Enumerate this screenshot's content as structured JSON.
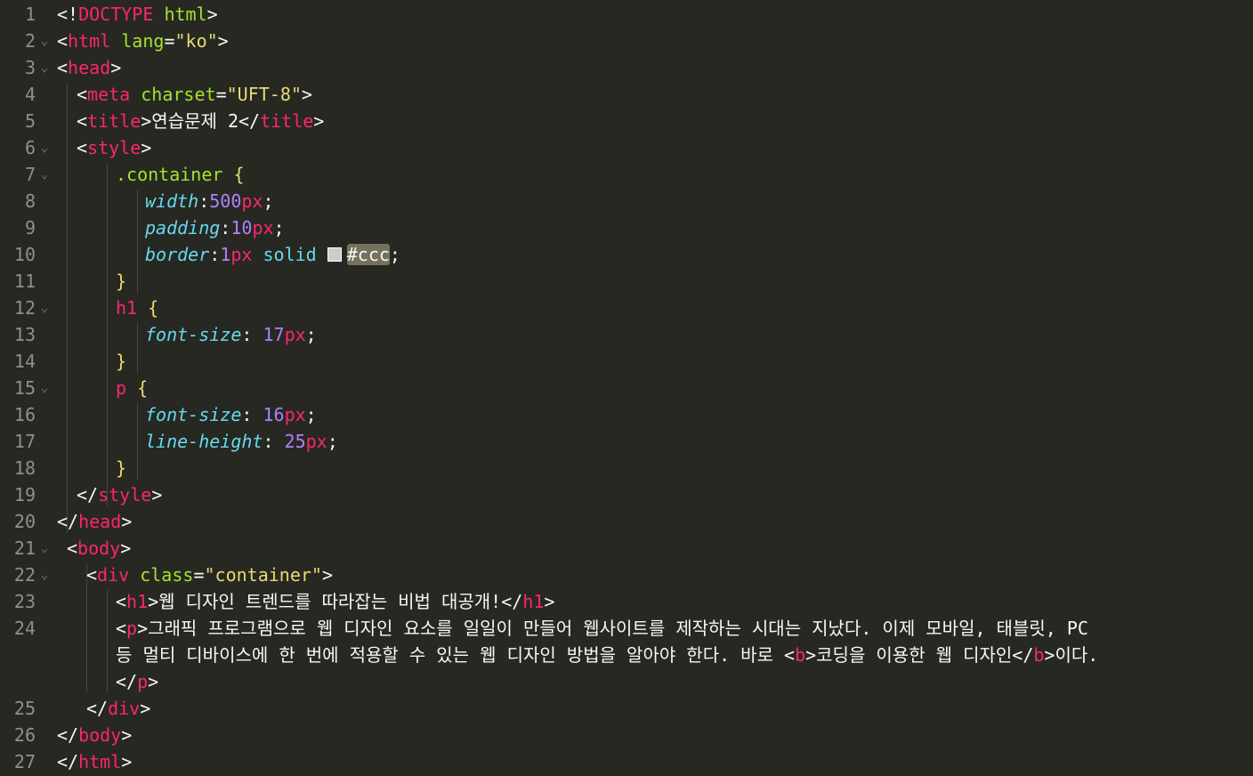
{
  "editor": {
    "language": "html",
    "theme_colors": {
      "background": "#272822",
      "foreground": "#f8f8f2",
      "line_number": "#8f908a",
      "tag": "#f92672",
      "attribute": "#a6e22e",
      "string": "#e6db74",
      "property": "#66d9ef",
      "number": "#ae81ff"
    },
    "color_swatch": "#ccc",
    "lines": [
      {
        "no": "1",
        "fold": false,
        "indent": 0,
        "tokens": [
          [
            "p",
            "<!"
          ],
          [
            "tag",
            "DOCTYPE"
          ],
          [
            "p",
            " "
          ],
          [
            "attr",
            "html"
          ],
          [
            "p",
            ">"
          ]
        ]
      },
      {
        "no": "2",
        "fold": true,
        "indent": 0,
        "tokens": [
          [
            "p",
            "<"
          ],
          [
            "tag",
            "html"
          ],
          [
            "p",
            " "
          ],
          [
            "attr",
            "lang"
          ],
          [
            "p",
            "="
          ],
          [
            "str",
            "\"ko\""
          ],
          [
            "p",
            ">"
          ]
        ]
      },
      {
        "no": "3",
        "fold": true,
        "indent": 0,
        "tokens": [
          [
            "p",
            "<"
          ],
          [
            "tag",
            "head"
          ],
          [
            "p",
            ">"
          ]
        ]
      },
      {
        "no": "4",
        "fold": false,
        "indent": 1,
        "tokens": [
          [
            "p",
            "<"
          ],
          [
            "tag",
            "meta"
          ],
          [
            "p",
            " "
          ],
          [
            "attr",
            "charset"
          ],
          [
            "p",
            "="
          ],
          [
            "str",
            "\"UFT-8\""
          ],
          [
            "p",
            ">"
          ]
        ]
      },
      {
        "no": "5",
        "fold": false,
        "indent": 1,
        "tokens": [
          [
            "p",
            "<"
          ],
          [
            "tag",
            "title"
          ],
          [
            "p",
            ">연습문제 2</"
          ],
          [
            "tag",
            "title"
          ],
          [
            "p",
            ">"
          ]
        ]
      },
      {
        "no": "6",
        "fold": true,
        "indent": 1,
        "tokens": [
          [
            "p",
            "<"
          ],
          [
            "tag",
            "style"
          ],
          [
            "p",
            ">"
          ]
        ]
      },
      {
        "no": "7",
        "fold": true,
        "indent": 3,
        "tokens": [
          [
            "sel",
            ".container"
          ],
          [
            "p",
            " "
          ],
          [
            "brace",
            "{"
          ]
        ]
      },
      {
        "no": "8",
        "fold": false,
        "indent": 4.5,
        "tokens": [
          [
            "prop",
            "width"
          ],
          [
            "p",
            ":"
          ],
          [
            "num",
            "500"
          ],
          [
            "unit",
            "px"
          ],
          [
            "p",
            ";"
          ]
        ]
      },
      {
        "no": "9",
        "fold": false,
        "indent": 4.5,
        "tokens": [
          [
            "prop",
            "padding"
          ],
          [
            "p",
            ":"
          ],
          [
            "num",
            "10"
          ],
          [
            "unit",
            "px"
          ],
          [
            "p",
            ";"
          ]
        ]
      },
      {
        "no": "10",
        "fold": false,
        "indent": 4.5,
        "tokens": [
          [
            "prop",
            "border"
          ],
          [
            "p",
            ":"
          ],
          [
            "num",
            "1"
          ],
          [
            "unit",
            "px"
          ],
          [
            "p",
            " "
          ],
          [
            "kw",
            "solid"
          ],
          [
            "p",
            " "
          ],
          [
            "swatch",
            ""
          ],
          [
            "hl",
            "#ccc"
          ],
          [
            "p",
            ";"
          ]
        ]
      },
      {
        "no": "11",
        "fold": false,
        "indent": 3,
        "tokens": [
          [
            "brace",
            "}"
          ]
        ]
      },
      {
        "no": "12",
        "fold": true,
        "indent": 3,
        "tokens": [
          [
            "tag",
            "h1"
          ],
          [
            "p",
            " "
          ],
          [
            "brace",
            "{"
          ]
        ]
      },
      {
        "no": "13",
        "fold": false,
        "indent": 4.5,
        "tokens": [
          [
            "prop",
            "font-size"
          ],
          [
            "p",
            ": "
          ],
          [
            "num",
            "17"
          ],
          [
            "unit",
            "px"
          ],
          [
            "p",
            ";"
          ]
        ]
      },
      {
        "no": "14",
        "fold": false,
        "indent": 3,
        "tokens": [
          [
            "brace",
            "}"
          ]
        ]
      },
      {
        "no": "15",
        "fold": true,
        "indent": 3,
        "tokens": [
          [
            "tag",
            "p"
          ],
          [
            "p",
            " "
          ],
          [
            "brace",
            "{"
          ]
        ]
      },
      {
        "no": "16",
        "fold": false,
        "indent": 4.5,
        "tokens": [
          [
            "prop",
            "font-size"
          ],
          [
            "p",
            ": "
          ],
          [
            "num",
            "16"
          ],
          [
            "unit",
            "px"
          ],
          [
            "p",
            ";"
          ]
        ]
      },
      {
        "no": "17",
        "fold": false,
        "indent": 4.5,
        "tokens": [
          [
            "prop",
            "line-height"
          ],
          [
            "p",
            ": "
          ],
          [
            "num",
            "25"
          ],
          [
            "unit",
            "px"
          ],
          [
            "p",
            ";"
          ]
        ]
      },
      {
        "no": "18",
        "fold": false,
        "indent": 3,
        "tokens": [
          [
            "brace",
            "}"
          ]
        ]
      },
      {
        "no": "19",
        "fold": false,
        "indent": 1,
        "tokens": [
          [
            "p",
            "</"
          ],
          [
            "tag",
            "style"
          ],
          [
            "p",
            ">"
          ]
        ]
      },
      {
        "no": "20",
        "fold": false,
        "indent": 0,
        "tokens": [
          [
            "p",
            "</"
          ],
          [
            "tag",
            "head"
          ],
          [
            "p",
            ">"
          ]
        ]
      },
      {
        "no": "21",
        "fold": true,
        "indent": 0.5,
        "tokens": [
          [
            "p",
            "<"
          ],
          [
            "tag",
            "body"
          ],
          [
            "p",
            ">"
          ]
        ]
      },
      {
        "no": "22",
        "fold": true,
        "indent": 1.5,
        "tokens": [
          [
            "p",
            "<"
          ],
          [
            "tag",
            "div"
          ],
          [
            "p",
            " "
          ],
          [
            "attr",
            "class"
          ],
          [
            "p",
            "="
          ],
          [
            "str",
            "\"container\""
          ],
          [
            "p",
            ">"
          ]
        ]
      },
      {
        "no": "23",
        "fold": false,
        "indent": 3,
        "tokens": [
          [
            "p",
            "<"
          ],
          [
            "tag",
            "h1"
          ],
          [
            "p",
            ">웹 디자인 트렌드를 따라잡는 비법 대공개!</"
          ],
          [
            "tag",
            "h1"
          ],
          [
            "p",
            ">"
          ]
        ]
      },
      {
        "no": "24",
        "fold": false,
        "indent": 3,
        "tokens": [
          [
            "p",
            "<"
          ],
          [
            "tag",
            "p"
          ],
          [
            "p",
            ">그래픽 프로그램으로 웹 디자인 요소를 일일이 만들어 웹사이트를 제작하는 시대는 지났다. 이제 모바일, 태블릿, PC"
          ]
        ]
      },
      {
        "no": "",
        "fold": false,
        "indent": 3,
        "tokens": [
          [
            "p",
            "등 멀티 디바이스에 한 번에 적용할 수 있는 웹 디자인 방법을 알아야 한다. 바로 <"
          ],
          [
            "tag",
            "b"
          ],
          [
            "p",
            ">코딩을 이용한 웹 디자인</"
          ],
          [
            "tag",
            "b"
          ],
          [
            "p",
            ">이다."
          ]
        ]
      },
      {
        "no": "",
        "fold": false,
        "indent": 3,
        "tokens": [
          [
            "p",
            "</"
          ],
          [
            "tag",
            "p"
          ],
          [
            "p",
            ">"
          ]
        ]
      },
      {
        "no": "25",
        "fold": false,
        "indent": 1.5,
        "tokens": [
          [
            "p",
            "</"
          ],
          [
            "tag",
            "div"
          ],
          [
            "p",
            ">"
          ]
        ]
      },
      {
        "no": "26",
        "fold": false,
        "indent": 0,
        "tokens": [
          [
            "p",
            "</"
          ],
          [
            "tag",
            "body"
          ],
          [
            "p",
            ">"
          ]
        ]
      },
      {
        "no": "27",
        "fold": false,
        "indent": 0,
        "tokens": [
          [
            "p",
            "</"
          ],
          [
            "tag",
            "html"
          ],
          [
            "p",
            ">"
          ]
        ]
      }
    ]
  }
}
